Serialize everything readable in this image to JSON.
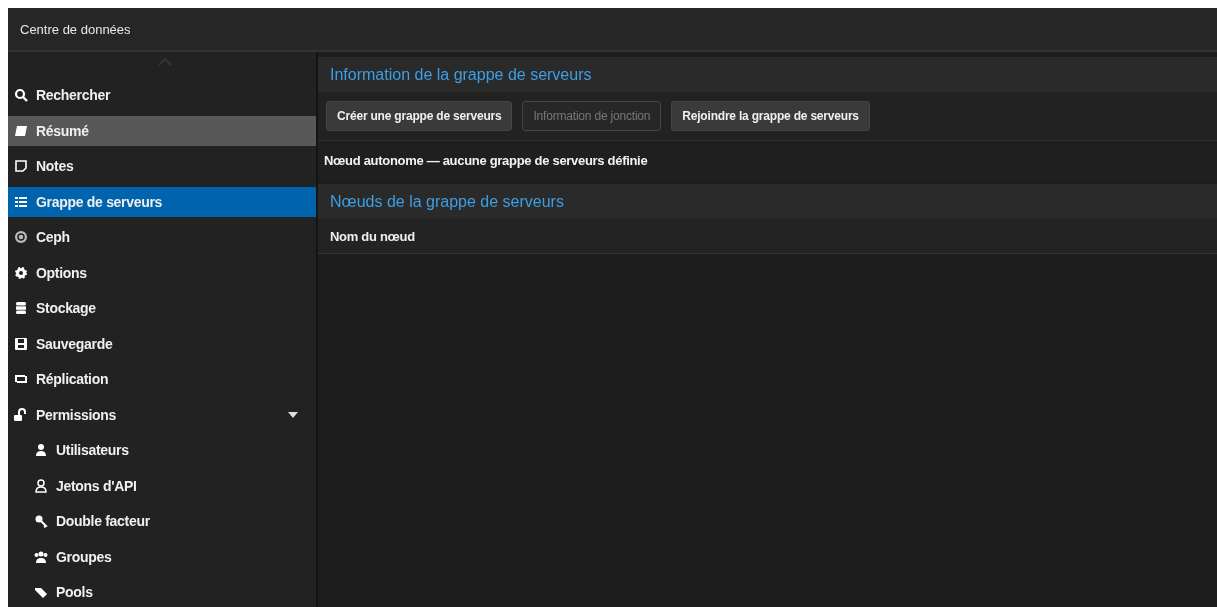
{
  "top_bar": {
    "title": "Centre de données"
  },
  "sidebar": {
    "items": [
      {
        "label": "Rechercher",
        "selected": false,
        "highlighted": false
      },
      {
        "label": "Résumé",
        "selected": false,
        "highlighted": true
      },
      {
        "label": "Notes",
        "selected": false,
        "highlighted": false
      },
      {
        "label": "Grappe de serveurs",
        "selected": true,
        "highlighted": false
      },
      {
        "label": "Ceph",
        "selected": false,
        "highlighted": false
      },
      {
        "label": "Options",
        "selected": false,
        "highlighted": false
      },
      {
        "label": "Stockage",
        "selected": false,
        "highlighted": false
      },
      {
        "label": "Sauvegarde",
        "selected": false,
        "highlighted": false
      },
      {
        "label": "Réplication",
        "selected": false,
        "highlighted": false
      },
      {
        "label": "Permissions",
        "selected": false,
        "highlighted": false,
        "expanded": true,
        "children": [
          {
            "label": "Utilisateurs",
            "selected": false,
            "highlighted": false
          },
          {
            "label": "Jetons d'API",
            "selected": false,
            "highlighted": false
          },
          {
            "label": "Double facteur",
            "selected": false,
            "highlighted": false
          },
          {
            "label": "Groupes",
            "selected": false,
            "highlighted": false
          },
          {
            "label": "Pools",
            "selected": false,
            "highlighted": false
          }
        ]
      }
    ]
  },
  "cluster_info": {
    "title": "Information de la grappe de serveurs",
    "buttons": [
      {
        "label": "Créer une grappe de serveurs",
        "disabled": false
      },
      {
        "label": "Information de jonction",
        "disabled": true
      },
      {
        "label": "Rejoindre la grappe de serveurs",
        "disabled": false
      }
    ],
    "status": "Nœud autonome — aucune grappe de serveurs définie"
  },
  "cluster_nodes": {
    "title": "Nœuds de la grappe de serveurs",
    "columns": [
      "Nom du nœud"
    ]
  }
}
